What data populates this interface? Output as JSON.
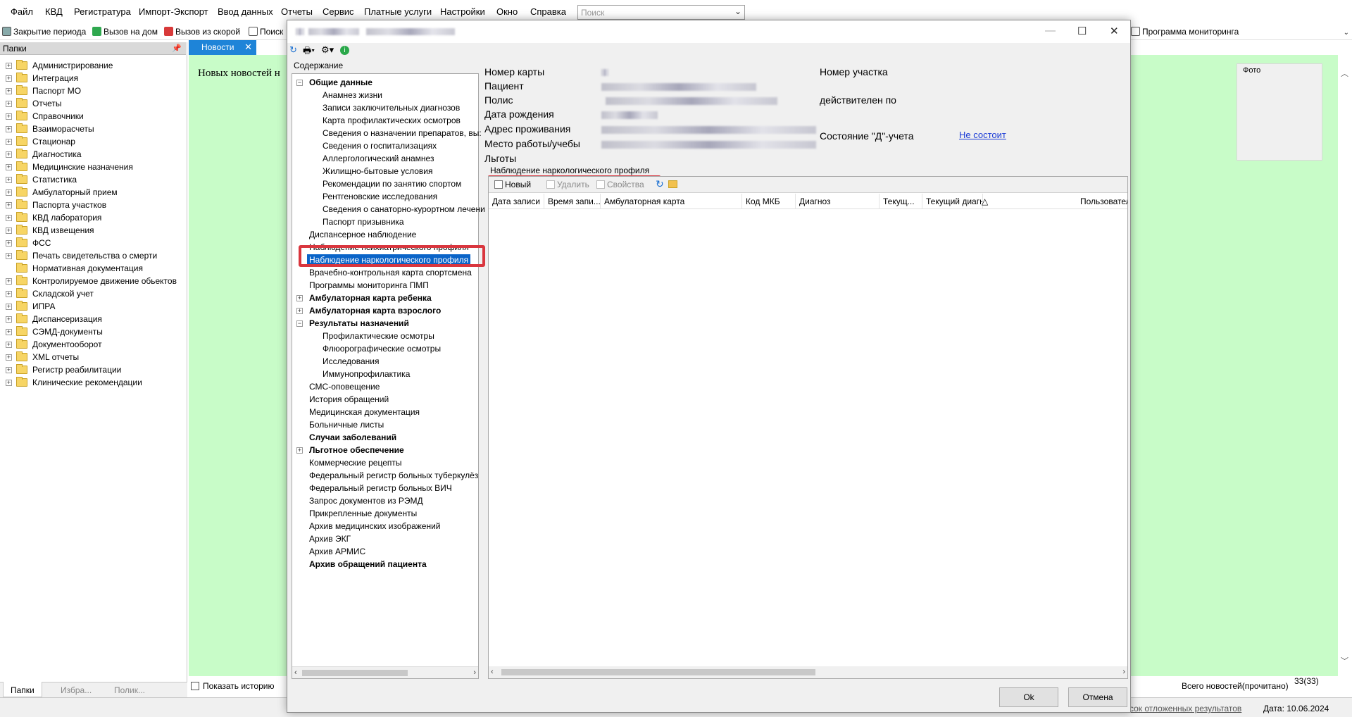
{
  "menu": [
    "Файл",
    "КВД",
    "Регистратура",
    "Импорт-Экспорт",
    "Ввод данных",
    "Отчеты",
    "Сервис",
    "Платные услуги",
    "Настройки",
    "Окно",
    "Справка"
  ],
  "search": {
    "placeholder": "Поиск"
  },
  "toolbar": {
    "items": [
      "Закрытие периода",
      "Вызов на дом",
      "Вызов из скорой",
      "Поиск"
    ],
    "right_item": "Программа мониторинга"
  },
  "folders": {
    "header": "Папки",
    "items": [
      "Администрирование",
      "Интеграция",
      "Паспорт МО",
      "Отчеты",
      "Справочники",
      "Взаиморасчеты",
      "Стационар",
      "Диагностика",
      "Медицинские назначения",
      "Статистика",
      "Амбулаторный прием",
      "Паспорта участков",
      "КВД лаборатория",
      "КВД извещения",
      "ФСС",
      "Печать свидетельства о смерти",
      "Нормативная документация",
      "Контролируемое движение обьектов",
      "Складской учет",
      "ИПРА",
      "Диспансеризация",
      "СЭМД-документы",
      "Документооборот",
      "XML отчеты",
      "Регистр реабилитации",
      "Клинические рекомендации"
    ],
    "no_expander_index": 16
  },
  "left_tabs": [
    "Папки",
    "Избра...",
    "Полик..."
  ],
  "news": {
    "tab_label": "Новости",
    "text": "Новых новостей н",
    "show_history": "Показать историю",
    "total": "Всего новостей(прочитано)",
    "count": "33(33)"
  },
  "statusbar": {
    "link": "сок отложенных результатов",
    "date": "Дата: 10.06.2024"
  },
  "dialog": {
    "contents_label": "Содержание",
    "tree": [
      {
        "label": "Общие данные",
        "level": 0,
        "bold": true,
        "exp": "-"
      },
      {
        "label": "Анамнез жизни",
        "level": 1
      },
      {
        "label": "Записи заключительных диагнозов",
        "level": 1
      },
      {
        "label": "Карта профилактических осмотров",
        "level": 1
      },
      {
        "label": "Сведения о назначении препаратов, вы:",
        "level": 1
      },
      {
        "label": "Сведения о госпитализациях",
        "level": 1
      },
      {
        "label": "Аллергологический анамнез",
        "level": 1
      },
      {
        "label": "Жилищно-бытовые условия",
        "level": 1
      },
      {
        "label": "Рекомендации по занятию спортом",
        "level": 1
      },
      {
        "label": "Рентгеновские исследования",
        "level": 1
      },
      {
        "label": "Сведения о санаторно-курортном лечени",
        "level": 1
      },
      {
        "label": "Паспорт призывника",
        "level": 1
      },
      {
        "label": "Диспансерное наблюдение",
        "level": 0
      },
      {
        "label": "Наблюдение психиатрического профиля",
        "level": 0
      },
      {
        "label": "Наблюдение наркологического профиля",
        "level": 0,
        "selected": true
      },
      {
        "label": "Врачебно-контрольная карта спортсмена",
        "level": 0
      },
      {
        "label": "Программы мониторинга ПМП",
        "level": 0
      },
      {
        "label": "Амбулаторная карта ребенка",
        "level": 0,
        "bold": true,
        "exp": "+"
      },
      {
        "label": "Амбулаторная карта взрослого",
        "level": 0,
        "bold": true,
        "exp": "+"
      },
      {
        "label": "Результаты назначений",
        "level": 0,
        "bold": true,
        "exp": "-"
      },
      {
        "label": "Профилактические осмотры",
        "level": 1
      },
      {
        "label": "Флюорографические осмотры",
        "level": 1
      },
      {
        "label": "Исследования",
        "level": 1
      },
      {
        "label": "Иммунопрофилактика",
        "level": 1
      },
      {
        "label": "СМС-оповещение",
        "level": 0
      },
      {
        "label": "История обращений",
        "level": 0
      },
      {
        "label": "Медицинская документация",
        "level": 0
      },
      {
        "label": "Больничные листы",
        "level": 0
      },
      {
        "label": "Случаи заболеваний",
        "level": 0,
        "bold": true
      },
      {
        "label": "Льготное обеспечение",
        "level": 0,
        "bold": true,
        "exp": "+"
      },
      {
        "label": "Коммерческие рецепты",
        "level": 0
      },
      {
        "label": "Федеральный регистр больных туберкулёз",
        "level": 0
      },
      {
        "label": "Федеральный регистр больных ВИЧ",
        "level": 0
      },
      {
        "label": "Запрос документов из РЭМД",
        "level": 0
      },
      {
        "label": "Прикрепленные документы",
        "level": 0
      },
      {
        "label": "Архив медицинских изображений",
        "level": 0
      },
      {
        "label": "Архив ЭКГ",
        "level": 0
      },
      {
        "label": "Архив АРМИС",
        "level": 0
      },
      {
        "label": "Архив обращений пациента",
        "level": 0,
        "bold": true
      }
    ],
    "info": {
      "card_number": "Номер карты",
      "patient": "Пациент",
      "policy": "Полис",
      "birth_date": "Дата рождения",
      "address": "Адрес проживания",
      "work": "Место работы/учебы",
      "benefits": "Льготы",
      "district": "Номер участка",
      "valid_until": "действителен по",
      "d_status": "Состояние \"Д\"-учета",
      "d_status_value": "Не состоит",
      "photo": "Фото"
    },
    "section_tab": "Наблюдение наркологического профиля",
    "grid_toolbar": {
      "new": "Новый",
      "delete": "Удалить",
      "properties": "Свойства"
    },
    "columns": [
      "Дата записи",
      "Время запи...",
      "Амбулаторная карта",
      "Код МКБ",
      "Диагноз",
      "Текущ...",
      "Текущий диагноз",
      "Пользователь"
    ],
    "sort_indicator": "△",
    "ok": "Ok",
    "cancel": "Отмена"
  }
}
